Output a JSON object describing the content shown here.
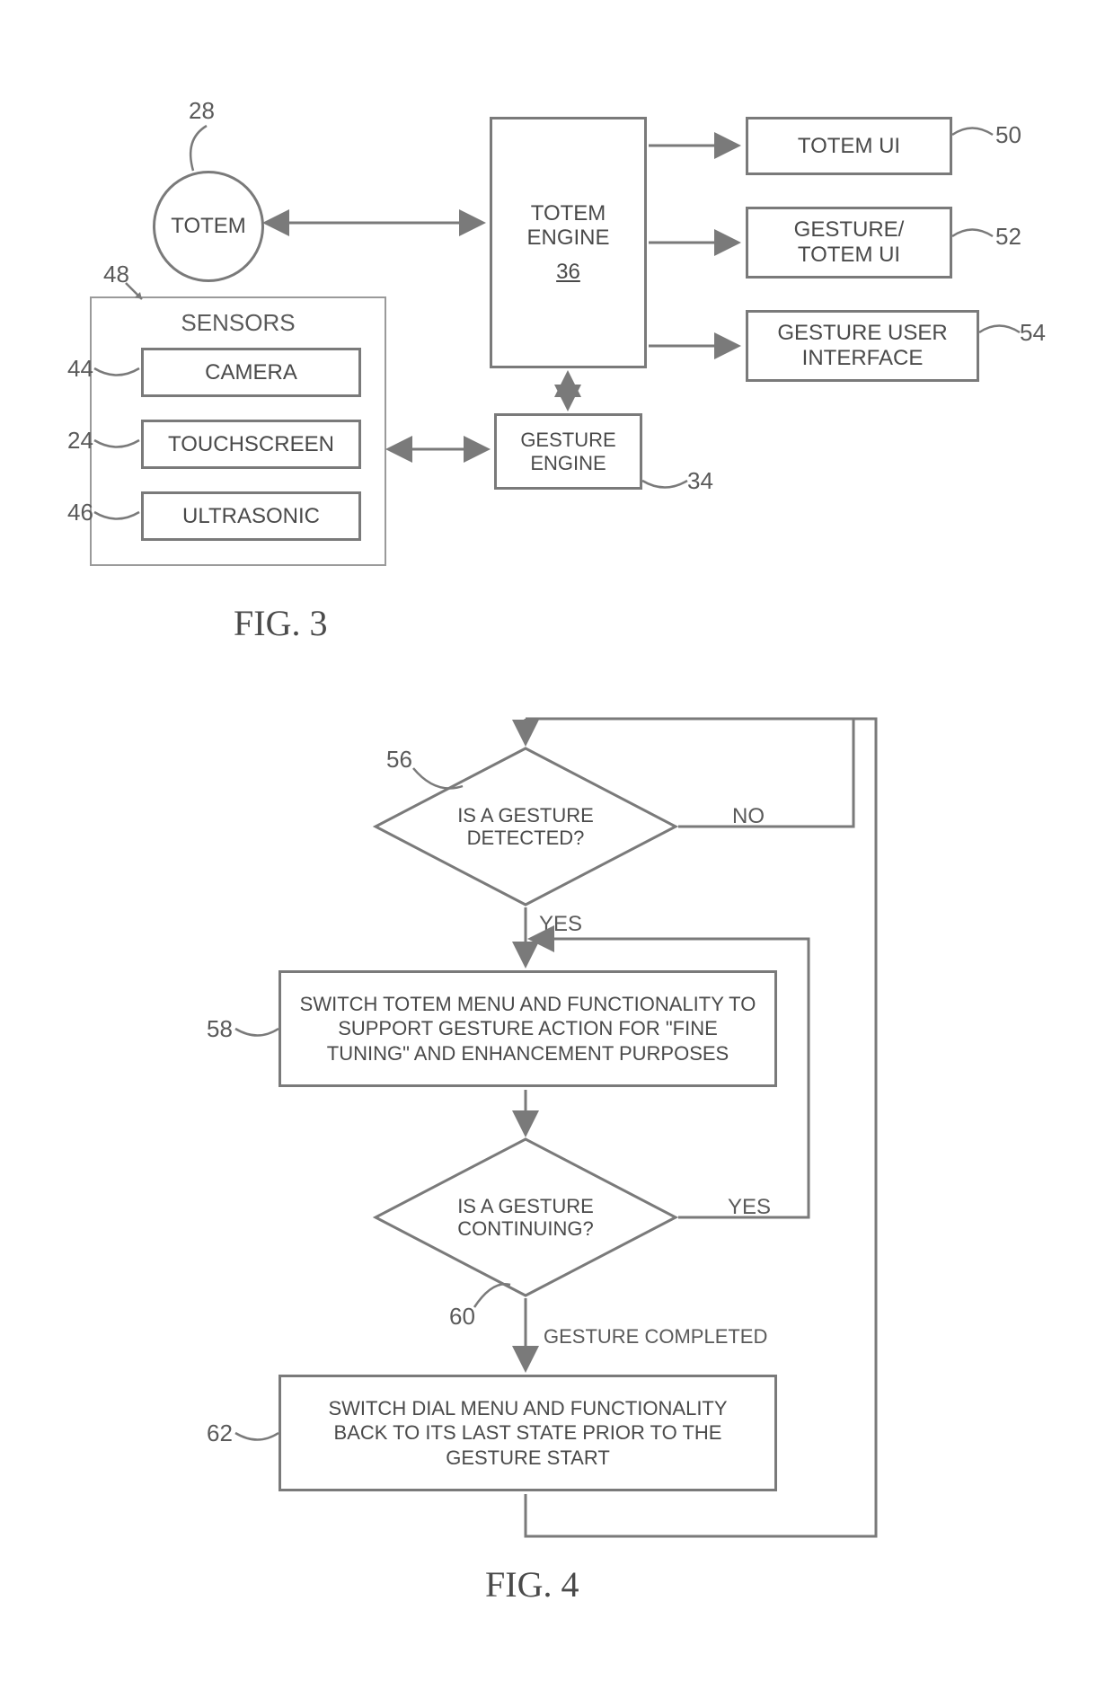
{
  "fig3": {
    "caption": "FIG. 3",
    "totem": {
      "label": "TOTEM",
      "ref": "28"
    },
    "sensors": {
      "title": "SENSORS",
      "ref": "48",
      "camera": {
        "label": "CAMERA",
        "ref": "44"
      },
      "touchscreen": {
        "label": "TOUCHSCREEN",
        "ref": "24"
      },
      "ultrasonic": {
        "label": "ULTRASONIC",
        "ref": "46"
      }
    },
    "totem_engine": {
      "label_line1": "TOTEM",
      "label_line2": "ENGINE",
      "ref": "36"
    },
    "gesture_engine": {
      "label_line1": "GESTURE",
      "label_line2": "ENGINE",
      "ref": "34"
    },
    "totem_ui": {
      "label": "TOTEM UI",
      "ref": "50"
    },
    "gesture_totem_ui": {
      "label_line1": "GESTURE/",
      "label_line2": "TOTEM UI",
      "ref": "52"
    },
    "gesture_user_interface": {
      "label_line1": "GESTURE USER",
      "label_line2": "INTERFACE",
      "ref": "54"
    }
  },
  "fig4": {
    "caption": "FIG. 4",
    "d1": {
      "text": "IS A GESTURE DETECTED?",
      "ref": "56",
      "yes": "YES",
      "no": "NO"
    },
    "p1": {
      "text": "SWITCH TOTEM MENU AND FUNCTIONALITY TO SUPPORT GESTURE ACTION FOR \"FINE TUNING\" AND ENHANCEMENT PURPOSES",
      "ref": "58"
    },
    "d2": {
      "text": "IS A GESTURE CONTINUING?",
      "ref": "60",
      "yes": "YES",
      "completed": "GESTURE COMPLETED"
    },
    "p2": {
      "text": "SWITCH DIAL MENU AND FUNCTIONALITY BACK TO ITS LAST STATE PRIOR TO THE GESTURE START",
      "ref": "62"
    }
  }
}
